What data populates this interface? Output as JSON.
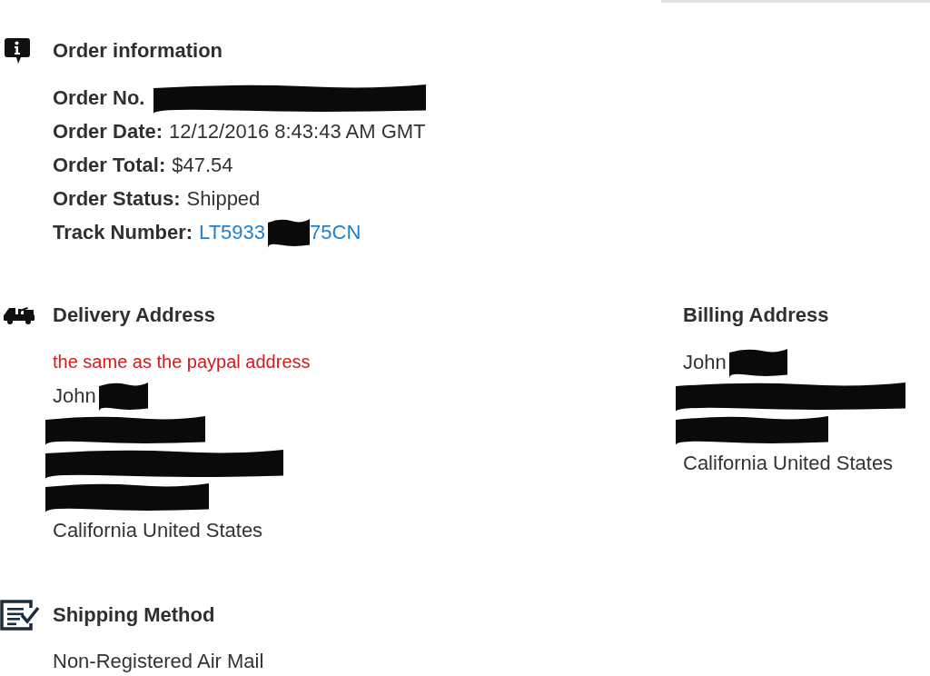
{
  "order_information": {
    "title": "Order information",
    "fields": [
      {
        "label": "Order No.",
        "segments": [
          {
            "kind": "redaction"
          }
        ]
      },
      {
        "label": "Order Date:",
        "segments": [
          {
            "kind": "text",
            "text": "12/12/2016 8:43:43 AM GMT"
          }
        ]
      },
      {
        "label": "Order Total:",
        "segments": [
          {
            "kind": "text",
            "text": "$47.54"
          }
        ]
      },
      {
        "label": "Order Status:",
        "segments": [
          {
            "kind": "text",
            "text": "Shipped"
          }
        ]
      },
      {
        "label": "Track Number:",
        "segments": [
          {
            "kind": "link",
            "text": "LT5933"
          },
          {
            "kind": "redaction"
          },
          {
            "kind": "link",
            "text": "75CN"
          }
        ]
      }
    ]
  },
  "delivery_address": {
    "title": "Delivery Address",
    "note": "the same as the paypal address",
    "lines": [
      {
        "segments": [
          {
            "kind": "text",
            "text": "John"
          },
          {
            "kind": "redaction"
          }
        ]
      },
      {
        "segments": [
          {
            "kind": "redaction"
          }
        ]
      },
      {
        "segments": [
          {
            "kind": "redaction"
          }
        ]
      },
      {
        "segments": [
          {
            "kind": "redaction"
          }
        ]
      },
      {
        "segments": [
          {
            "kind": "text",
            "text": "California United States"
          }
        ]
      }
    ]
  },
  "billing_address": {
    "title": "Billing Address",
    "lines": [
      {
        "segments": [
          {
            "kind": "text",
            "text": "John"
          },
          {
            "kind": "redaction"
          }
        ]
      },
      {
        "segments": [
          {
            "kind": "redaction"
          }
        ]
      },
      {
        "segments": [
          {
            "kind": "redaction"
          }
        ]
      },
      {
        "segments": [
          {
            "kind": "text",
            "text": "California United States"
          }
        ]
      }
    ]
  },
  "shipping_method": {
    "title": "Shipping Method",
    "value": "Non-Registered Air Mail"
  }
}
